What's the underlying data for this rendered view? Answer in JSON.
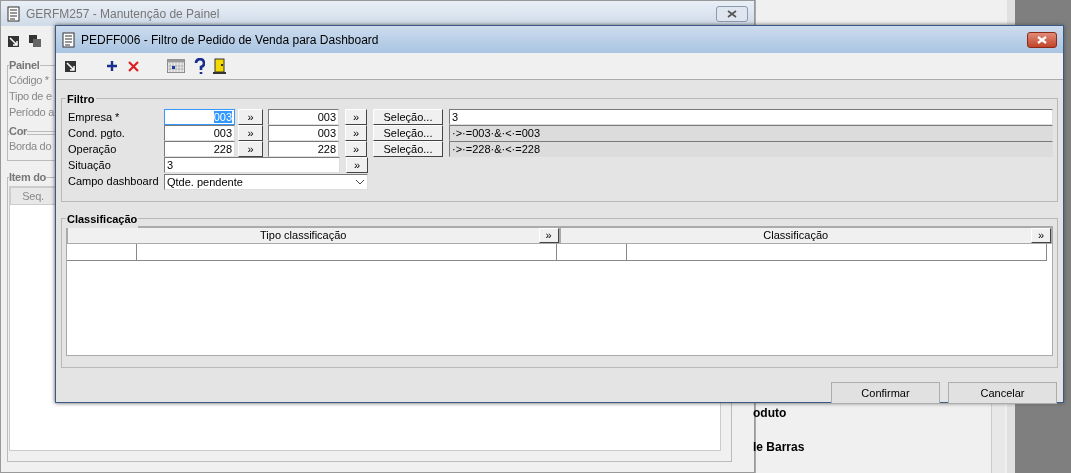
{
  "background_window": {
    "title": "GERFM257 - Manutenção de Painel",
    "panel_group": {
      "title": "Painel",
      "labels": [
        "Código *",
        "Tipo de e",
        "Período a"
      ]
    },
    "color_group": {
      "title": "Cor",
      "labels": [
        "Borda do"
      ]
    },
    "items_group": {
      "title": "Item do",
      "columns": [
        "Seq."
      ]
    },
    "side_list": [
      "oduto",
      "le Barras"
    ]
  },
  "dialog": {
    "title": "PEDFF006 - Filtro de Pedido de Venda para Dashboard",
    "filter": {
      "title": "Filtro",
      "rows": [
        {
          "kind": "range",
          "label": "Empresa *",
          "from": "003",
          "from_picker": "»",
          "to": "003",
          "to_picker": "»",
          "from_focused": true,
          "button": "Seleção...",
          "selection": "3",
          "selection_disabled": false
        },
        {
          "kind": "range",
          "label": "Cond. pgto.",
          "from": "003",
          "from_picker": "»",
          "to": "003",
          "to_picker": "»",
          "from_focused": false,
          "button": "Seleção...",
          "selection": "·>·=003·&·<·=003",
          "selection_disabled": true
        },
        {
          "kind": "range",
          "label": "Operação",
          "from": "228",
          "from_picker": "»",
          "to": "228",
          "to_picker": "»",
          "from_focused": false,
          "button": "Seleção...",
          "selection": "·>·=228·&·<·=228",
          "selection_disabled": true
        },
        {
          "kind": "text",
          "label": "Situação",
          "value": "3",
          "picker": "»"
        },
        {
          "kind": "select",
          "label": "Campo dashboard",
          "value": "Qtde. pendente"
        }
      ]
    },
    "classification": {
      "title": "Classificação",
      "columns": [
        {
          "label": "Tipo classificação",
          "picker": "»"
        },
        {
          "label": "Classificação",
          "picker": "»"
        }
      ]
    },
    "buttons": [
      "Confirmar",
      "Cancelar"
    ]
  }
}
